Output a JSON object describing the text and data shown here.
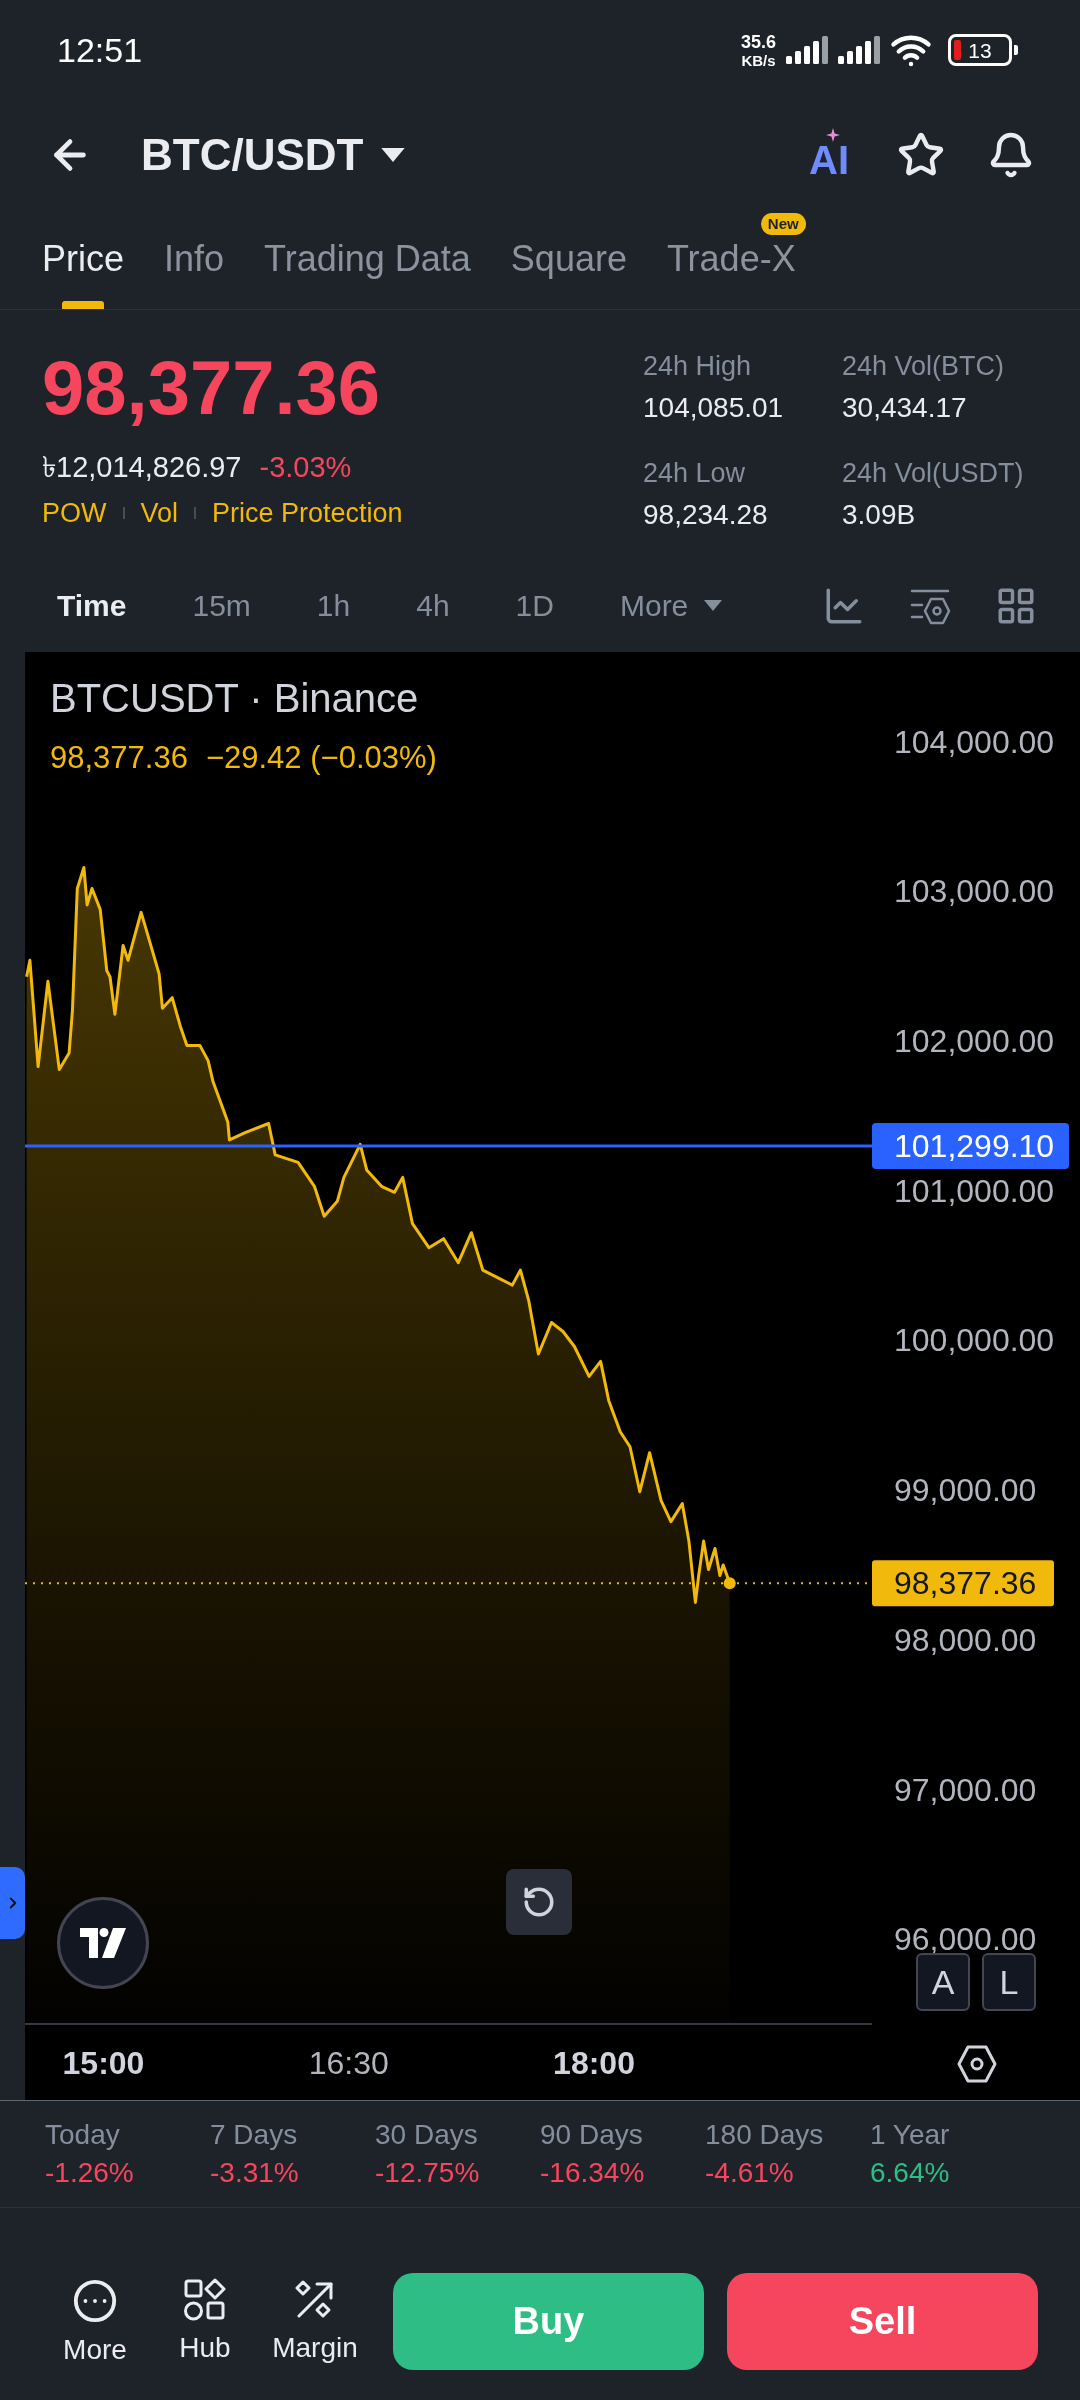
{
  "status_bar": {
    "time": "12:51",
    "net_speed_value": "35.6",
    "net_speed_unit": "KB/s",
    "battery": "13"
  },
  "header": {
    "pair": "BTC/USDT",
    "ai_label": "AI"
  },
  "tabs": [
    {
      "label": "Price",
      "selected": true
    },
    {
      "label": "Info",
      "selected": false
    },
    {
      "label": "Trading Data",
      "selected": false
    },
    {
      "label": "Square",
      "selected": false
    },
    {
      "label": "Trade-X",
      "selected": false,
      "badge": "New"
    }
  ],
  "price": {
    "last": "98,377.36",
    "fiat": "৳12,014,826.97",
    "change": "-3.03%",
    "tags": [
      "POW",
      "Vol",
      "Price Protection"
    ]
  },
  "stats": [
    {
      "label": "24h High",
      "value": "104,085.01"
    },
    {
      "label": "24h Vol(BTC)",
      "value": "30,434.17"
    },
    {
      "label": "24h Low",
      "value": "98,234.28"
    },
    {
      "label": "24h Vol(USDT)",
      "value": "3.09B"
    }
  ],
  "intervals": [
    {
      "label": "Time",
      "selected": true
    },
    {
      "label": "15m",
      "selected": false
    },
    {
      "label": "1h",
      "selected": false
    },
    {
      "label": "4h",
      "selected": false
    },
    {
      "label": "1D",
      "selected": false
    }
  ],
  "more_intervals": "More",
  "chart": {
    "legend_price": "98,377.36",
    "legend_change": "−29.42 (−0.03%)",
    "scale_buttons": [
      "A",
      "L"
    ],
    "time_label_bold": [
      true,
      false,
      true
    ],
    "chart_data": {
      "type": "area",
      "title": "BTCUSDT · Binance",
      "x": [
        14.53,
        14.55,
        14.6,
        14.66,
        14.73,
        14.79,
        14.81,
        14.84,
        14.88,
        14.9,
        14.93,
        14.98,
        15.02,
        15.04,
        15.07,
        15.12,
        15.15,
        15.18,
        15.23,
        15.26,
        15.34,
        15.36,
        15.42,
        15.47,
        15.51,
        15.59,
        15.64,
        15.67,
        15.76,
        15.77,
        15.87,
        16.01,
        16.05,
        16.19,
        16.29,
        16.35,
        16.43,
        16.47,
        16.57,
        16.61,
        16.7,
        16.78,
        16.83,
        16.89,
        16.99,
        17.08,
        17.17,
        17.25,
        17.32,
        17.41,
        17.5,
        17.55,
        17.6,
        17.66,
        17.74,
        17.81,
        17.88,
        17.97,
        18.04,
        18.09,
        18.16,
        18.22,
        18.28,
        18.34,
        18.41,
        18.47,
        18.54,
        18.58,
        18.62,
        18.64,
        18.67,
        18.7,
        18.74,
        18.77,
        18.79,
        18.83
      ],
      "series": [
        {
          "color": "#f0b90b",
          "values": [
            102430,
            102540,
            101830,
            102400,
            101810,
            101920,
            102200,
            103020,
            103160,
            102910,
            103020,
            102880,
            102470,
            102430,
            102180,
            102640,
            102540,
            102660,
            102860,
            102750,
            102450,
            102220,
            102290,
            102100,
            101970,
            101970,
            101870,
            101730,
            101460,
            101340,
            101390,
            101450,
            101240,
            101190,
            101030,
            100830,
            100930,
            101090,
            101310,
            101140,
            101030,
            100990,
            101090,
            100780,
            100620,
            100680,
            100520,
            100720,
            100470,
            100420,
            100370,
            100470,
            100270,
            99910,
            100120,
            100060,
            99960,
            99760,
            99860,
            99600,
            99390,
            99290,
            98990,
            99250,
            98930,
            98790,
            98910,
            98660,
            98250,
            98430,
            98660,
            98470,
            98610,
            98430,
            98500,
            98380
          ]
        }
      ],
      "xlim": [
        14.52,
        19.7
      ],
      "ylim": [
        95440,
        104600
      ],
      "xticks": [
        {
          "value": 15,
          "label": "15:00"
        },
        {
          "value": 16.5,
          "label": "16:30"
        },
        {
          "value": 18,
          "label": "18:00"
        }
      ],
      "yticks": [
        {
          "value": 104000,
          "label": "104,000.00"
        },
        {
          "value": 103000,
          "label": "103,000.00"
        },
        {
          "value": 102000,
          "label": "102,000.00"
        },
        {
          "value": 101000,
          "label": "101,000.00"
        },
        {
          "value": 100000,
          "label": "100,000.00"
        },
        {
          "value": 99000,
          "label": "99,000.00"
        },
        {
          "value": 98000,
          "label": "98,000.00"
        },
        {
          "value": 97000,
          "label": "97,000.00"
        },
        {
          "value": 96000,
          "label": "96,000.00"
        }
      ],
      "ref_lines": [
        {
          "axis": "y",
          "value": 101299.1,
          "label": "101,299.10",
          "color": "#2962ff"
        },
        {
          "axis": "y",
          "value": 98377.36,
          "label": "98,377.36",
          "color": "#f0b90b"
        }
      ]
    }
  },
  "performance": [
    {
      "period": "Today",
      "change": "-1.26%",
      "color": "#f6465d"
    },
    {
      "period": "7 Days",
      "change": "-3.31%",
      "color": "#f6465d"
    },
    {
      "period": "30 Days",
      "change": "-12.75%",
      "color": "#f6465d"
    },
    {
      "period": "90 Days",
      "change": "-16.34%",
      "color": "#f6465d"
    },
    {
      "period": "180 Days",
      "change": "-4.61%",
      "color": "#f6465d"
    },
    {
      "period": "1 Year",
      "change": "6.64%",
      "color": "#2ebd85"
    }
  ],
  "bottom_bar": {
    "actions": [
      {
        "label": "More",
        "kind": "more"
      },
      {
        "label": "Hub",
        "kind": "hub"
      },
      {
        "label": "Margin",
        "kind": "margin"
      }
    ],
    "buy": "Buy",
    "sell": "Sell"
  }
}
